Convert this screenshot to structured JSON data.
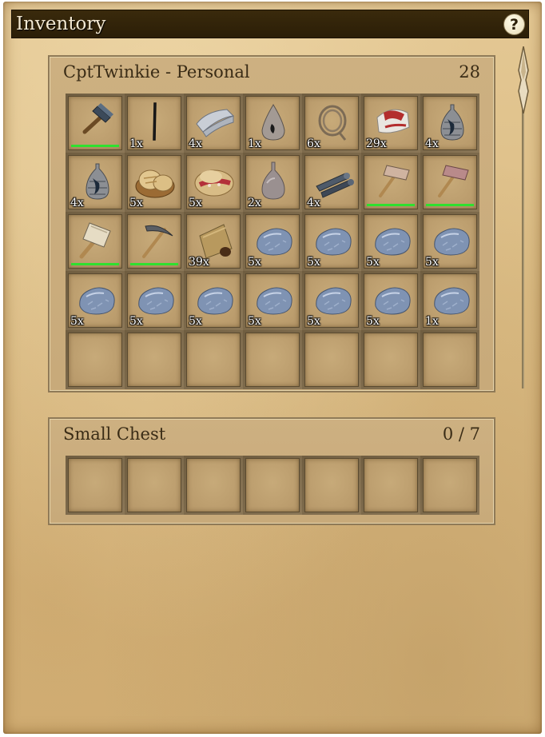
{
  "window": {
    "title": "Inventory",
    "help_label": "?"
  },
  "colors": {
    "titlebar": "#2b1e07",
    "parchment": "#dcbd85",
    "durability": "#2fe02f"
  },
  "personal": {
    "title": "CptTwinkie - Personal",
    "count": "28",
    "slots": [
      {
        "icon": "hammer-icon",
        "qty": "",
        "durability": 1.0
      },
      {
        "icon": "stick-icon",
        "qty": "1x",
        "durability": null
      },
      {
        "icon": "cloth-icon",
        "qty": "4x",
        "durability": null
      },
      {
        "icon": "oil-flask-icon",
        "qty": "1x",
        "durability": null
      },
      {
        "icon": "rope-icon",
        "qty": "6x",
        "durability": null
      },
      {
        "icon": "bandage-icon",
        "qty": "29x",
        "durability": null
      },
      {
        "icon": "waterskin-icon",
        "qty": "4x",
        "durability": null
      },
      {
        "icon": "waterskin-icon",
        "qty": "4x",
        "durability": null
      },
      {
        "icon": "bread-icon",
        "qty": "5x",
        "durability": null
      },
      {
        "icon": "sandwich-icon",
        "qty": "5x",
        "durability": null
      },
      {
        "icon": "gourd-icon",
        "qty": "2x",
        "durability": null
      },
      {
        "icon": "logs-icon",
        "qty": "4x",
        "durability": null
      },
      {
        "icon": "stone-hammer-icon",
        "qty": "",
        "durability": 1.0
      },
      {
        "icon": "copper-hammer-icon",
        "qty": "",
        "durability": 1.0
      },
      {
        "icon": "mallet-icon",
        "qty": "",
        "durability": 1.0
      },
      {
        "icon": "pickaxe-icon",
        "qty": "",
        "durability": 1.0
      },
      {
        "icon": "seed-pouch-icon",
        "qty": "39x",
        "durability": null
      },
      {
        "icon": "stone-icon",
        "qty": "5x",
        "durability": null
      },
      {
        "icon": "stone-icon",
        "qty": "5x",
        "durability": null
      },
      {
        "icon": "stone-icon",
        "qty": "5x",
        "durability": null
      },
      {
        "icon": "stone-icon",
        "qty": "5x",
        "durability": null
      },
      {
        "icon": "stone-icon",
        "qty": "5x",
        "durability": null
      },
      {
        "icon": "stone-icon",
        "qty": "5x",
        "durability": null
      },
      {
        "icon": "stone-icon",
        "qty": "5x",
        "durability": null
      },
      {
        "icon": "stone-icon",
        "qty": "5x",
        "durability": null
      },
      {
        "icon": "stone-icon",
        "qty": "5x",
        "durability": null
      },
      {
        "icon": "stone-icon",
        "qty": "5x",
        "durability": null
      },
      {
        "icon": "stone-icon",
        "qty": "1x",
        "durability": null
      },
      {
        "icon": "",
        "qty": "",
        "durability": null
      },
      {
        "icon": "",
        "qty": "",
        "durability": null
      },
      {
        "icon": "",
        "qty": "",
        "durability": null
      },
      {
        "icon": "",
        "qty": "",
        "durability": null
      },
      {
        "icon": "",
        "qty": "",
        "durability": null
      },
      {
        "icon": "",
        "qty": "",
        "durability": null
      },
      {
        "icon": "",
        "qty": "",
        "durability": null
      }
    ]
  },
  "chest": {
    "title": "Small Chest",
    "count": "0 / 7",
    "slots": [
      {
        "icon": "",
        "qty": "",
        "durability": null
      },
      {
        "icon": "",
        "qty": "",
        "durability": null
      },
      {
        "icon": "",
        "qty": "",
        "durability": null
      },
      {
        "icon": "",
        "qty": "",
        "durability": null
      },
      {
        "icon": "",
        "qty": "",
        "durability": null
      },
      {
        "icon": "",
        "qty": "",
        "durability": null
      },
      {
        "icon": "",
        "qty": "",
        "durability": null
      }
    ]
  }
}
